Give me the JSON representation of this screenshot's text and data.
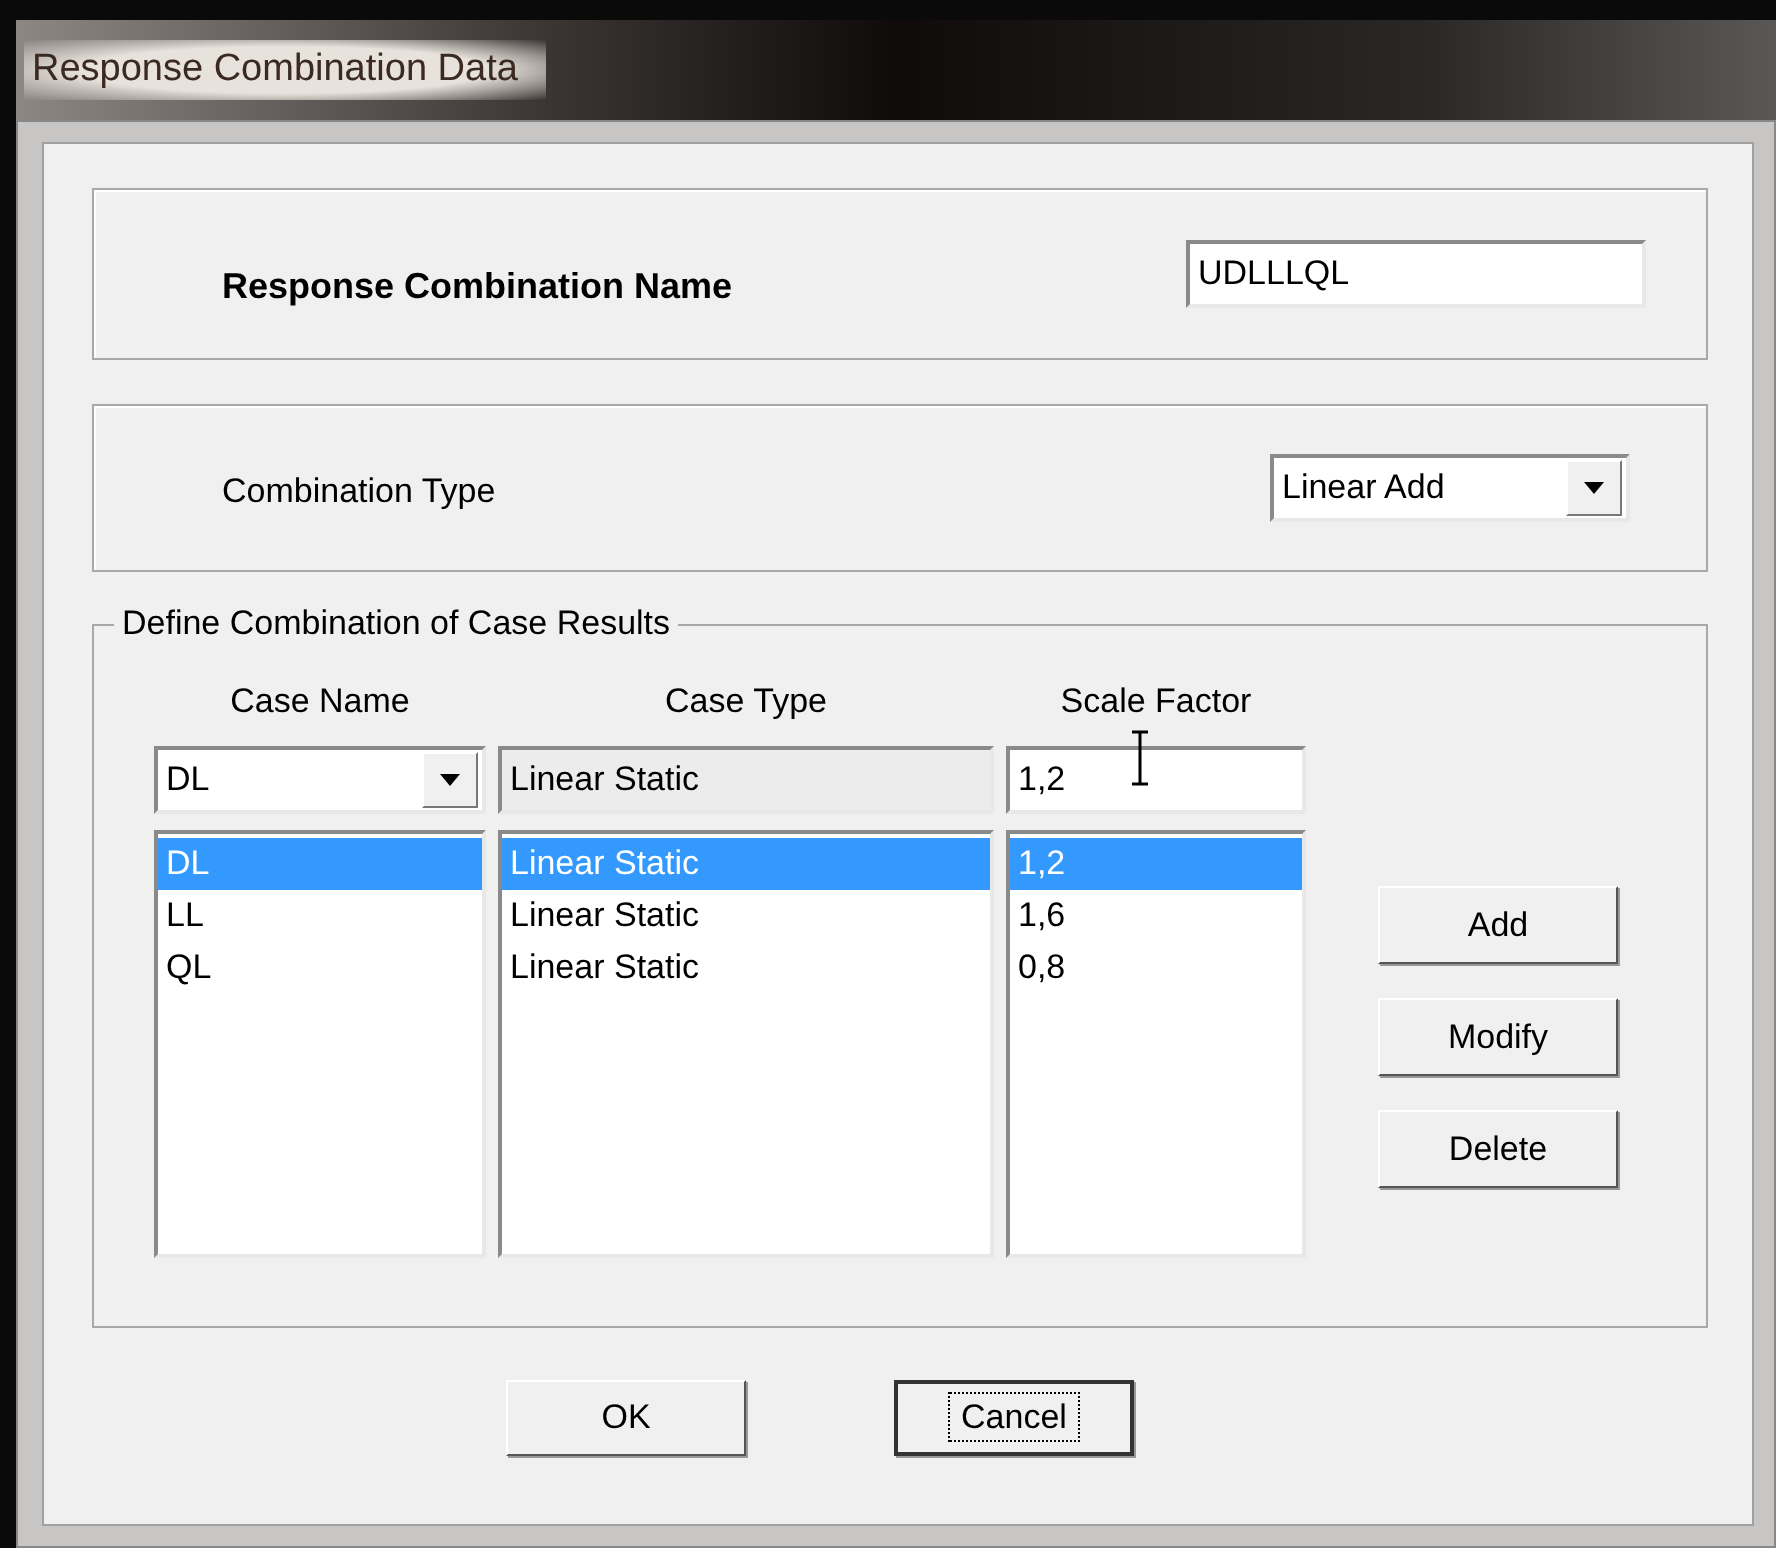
{
  "window": {
    "title": "Response Combination Data"
  },
  "name_section": {
    "label": "Response Combination Name",
    "value": "UDLLLQL"
  },
  "type_section": {
    "label": "Combination Type",
    "value": "Linear Add"
  },
  "cases_group": {
    "title": "Define Combination of Case Results",
    "columns": [
      "Case Name",
      "Case Type",
      "Scale Factor"
    ],
    "editor": {
      "case_name": "DL",
      "case_type": "Linear Static",
      "scale_factor": "1,2"
    },
    "rows": [
      {
        "case_name": "DL",
        "case_type": "Linear Static",
        "scale_factor": "1,2",
        "selected": true
      },
      {
        "case_name": "LL",
        "case_type": "Linear Static",
        "scale_factor": "1,6",
        "selected": false
      },
      {
        "case_name": "QL",
        "case_type": "Linear Static",
        "scale_factor": "0,8",
        "selected": false
      }
    ],
    "buttons": [
      "Add",
      "Modify",
      "Delete"
    ]
  },
  "buttons": [
    {
      "label": "OK",
      "focused": false
    },
    {
      "label": "Cancel",
      "focused": true
    }
  ]
}
